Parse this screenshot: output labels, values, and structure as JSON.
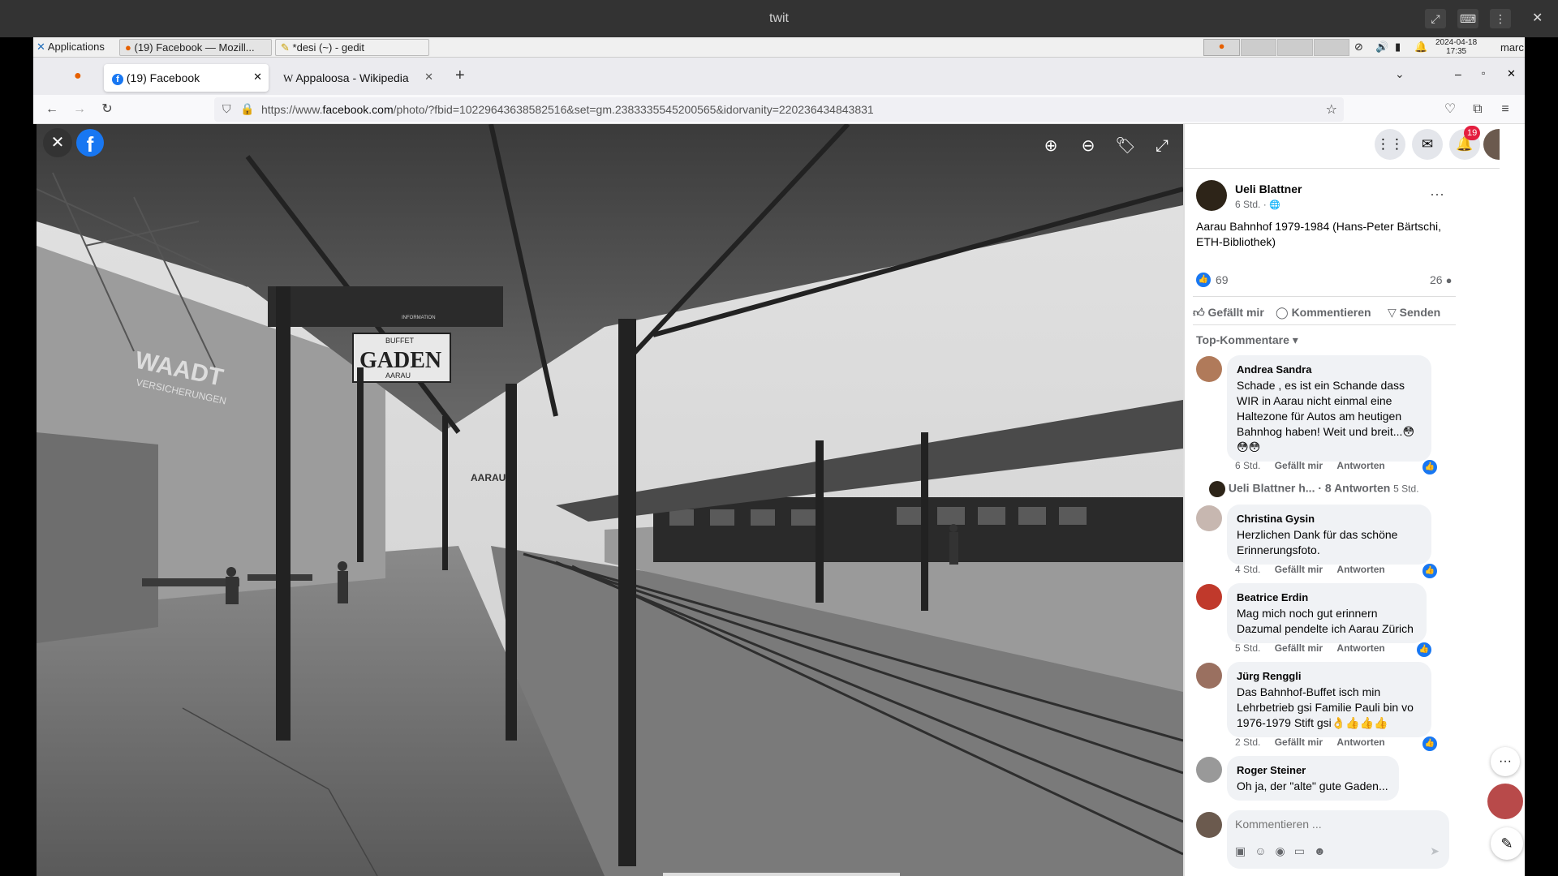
{
  "outer_window": {
    "title": "twit"
  },
  "panel": {
    "applications_label": "Applications",
    "tasks": [
      "(19) Facebook — Mozill...",
      "*desi (~) - gedit"
    ],
    "clock_date": "2024-04-18",
    "clock_time": "17:35",
    "user": "marc"
  },
  "browser": {
    "tabs": [
      {
        "label": "(19) Facebook"
      },
      {
        "label": "Appaloosa - Wikipedia"
      }
    ],
    "url_prefix": "https://www.",
    "url_domain": "facebook.com",
    "url_rest": "/photo/?fbid=10229643638582516&set=gm.2383335545200565&idorvanity=220236434843831"
  },
  "photo_signs": {
    "waadt": "WAADT",
    "versicherungen": "VERSICHERUNGEN",
    "buffet": "BUFFET",
    "gaden": "GADEN",
    "aarau": "AARAU",
    "information": "INFORMATION",
    "aarau_right": "AARAU"
  },
  "header": {
    "notification_count": "19"
  },
  "post": {
    "author": "Ueli Blattner",
    "time": "6 Std. ·",
    "text": "Aarau Bahnhof 1979-1984 (Hans-Peter Bärtschi, ETH-Bibliothek)",
    "likes": "69",
    "comments_count": "26",
    "actions": {
      "like": "Gefällt mir",
      "comment": "Kommentieren",
      "send": "Senden"
    },
    "sort_label": "Top-Kommentare"
  },
  "comments": [
    {
      "name": "Andrea Sandra",
      "text": "Schade , es ist ein Schande dass WIR in Aarau nicht einmal eine Haltezone für Autos am heutigen Bahnhog haben! Weit und breit...😳😳😳",
      "time": "6 Std.",
      "like": "Gefällt mir",
      "reply": "Antworten"
    },
    {
      "name": "Christina Gysin",
      "text": "Herzlichen Dank für das schöne Erinnerungsfoto.",
      "time": "4 Std.",
      "like": "Gefällt mir",
      "reply": "Antworten"
    },
    {
      "name": "Beatrice Erdin",
      "text": "Mag mich noch gut erinnern Dazumal pendelte ich Aarau Zürich",
      "time": "5 Std.",
      "like": "Gefällt mir",
      "reply": "Antworten"
    },
    {
      "name": "Jürg Renggli",
      "text": "Das Bahnhof-Buffet isch min Lehrbetrieb gsi Familie Pauli bin vo 1976-1979 Stift gsi👌👍👍👍",
      "time": "2 Std.",
      "like": "Gefällt mir",
      "reply": "Antworten"
    },
    {
      "name": "Roger Steiner",
      "text": "Oh ja, der \"alte\" gute Gaden..."
    }
  ],
  "replies_row": {
    "name": "Ueli Blattner h...",
    "count": "· 8 Antworten",
    "time": "5 Std."
  },
  "composer": {
    "placeholder": "Kommentieren ..."
  },
  "icons": [
    "close-icon",
    "facebook-logo-icon",
    "zoom-in-icon",
    "zoom-out-icon",
    "tag-icon",
    "fullscreen-icon",
    "apps-grid-icon",
    "messenger-icon",
    "bell-icon",
    "more-icon",
    "like-icon",
    "comment-icon",
    "send-icon",
    "sticker-icon",
    "emoji-icon",
    "camera-icon",
    "gif-icon",
    "avatar-sticker-icon",
    "send-arrow-icon",
    "edit-icon"
  ],
  "colors": {
    "facebook_blue": "#1877f2",
    "notification_red": "#e41e3f"
  }
}
